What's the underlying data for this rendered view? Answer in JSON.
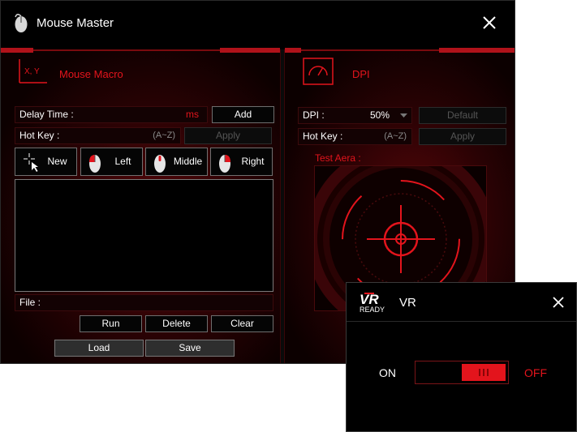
{
  "window": {
    "title": "Mouse Master"
  },
  "macro": {
    "section_title": "Mouse Macro",
    "icon_text": "X, Y",
    "delay_label": "Delay Time :",
    "delay_unit": "ms",
    "add_label": "Add",
    "hotkey_label": "Hot Key :",
    "hotkey_hint": "(A~Z)",
    "apply_label": "Apply",
    "buttons": {
      "new": "New",
      "left": "Left",
      "middle": "Middle",
      "right": "Right"
    },
    "file_label": "File :",
    "run_label": "Run",
    "delete_label": "Delete",
    "clear_label": "Clear",
    "load_label": "Load",
    "save_label": "Save"
  },
  "dpi": {
    "section_title": "DPI",
    "dpi_label": "DPI :",
    "dpi_value": "50%",
    "default_label": "Default",
    "hotkey_label": "Hot Key :",
    "hotkey_hint": "(A~Z)",
    "apply_label": "Apply",
    "test_area_label": "Test Aera :"
  },
  "vr": {
    "logo_top": "VR",
    "logo_bottom": "READY",
    "title": "VR",
    "on_label": "ON",
    "off_label": "OFF"
  },
  "colors": {
    "accent": "#e3141c",
    "background": "#000000"
  }
}
